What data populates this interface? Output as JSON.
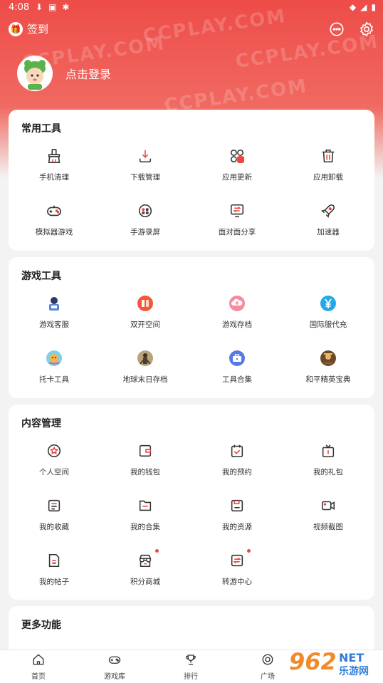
{
  "status_bar": {
    "time": "4:08",
    "icons": [
      "download-icon",
      "a-box-icon",
      "bug-icon",
      "wifi-icon",
      "signal-icon",
      "battery-icon"
    ]
  },
  "header": {
    "checkin_label": "签到",
    "watermark_text": "CCPLAY.COM",
    "login_label": "点击登录"
  },
  "sections": [
    {
      "title": "常用工具",
      "items": [
        {
          "label": "手机清理",
          "icon": "broom-icon"
        },
        {
          "label": "下载管理",
          "icon": "download-icon"
        },
        {
          "label": "应用更新",
          "icon": "apps-update-icon"
        },
        {
          "label": "应用卸载",
          "icon": "trash-icon"
        },
        {
          "label": "模拟器游戏",
          "icon": "gamepad-icon"
        },
        {
          "label": "手游录屏",
          "icon": "record-icon"
        },
        {
          "label": "面对面分享",
          "icon": "share-transfer-icon"
        },
        {
          "label": "加速器",
          "icon": "rocket-icon"
        }
      ]
    },
    {
      "title": "游戏工具",
      "items": [
        {
          "label": "游戏客服",
          "icon": "customer-service-icon"
        },
        {
          "label": "双开空间",
          "icon": "dual-space-icon"
        },
        {
          "label": "游戏存档",
          "icon": "cloud-save-icon"
        },
        {
          "label": "国际服代充",
          "icon": "yen-icon"
        },
        {
          "label": "托卡工具",
          "icon": "toca-icon"
        },
        {
          "label": "地球末日存档",
          "icon": "survivor-icon"
        },
        {
          "label": "工具合集",
          "icon": "toolbox-icon"
        },
        {
          "label": "和平精英宝典",
          "icon": "pubg-icon"
        }
      ]
    },
    {
      "title": "内容管理",
      "items": [
        {
          "label": "个人空间",
          "icon": "star-circle-icon",
          "dot": false
        },
        {
          "label": "我的钱包",
          "icon": "wallet-icon",
          "dot": false
        },
        {
          "label": "我的预约",
          "icon": "calendar-check-icon",
          "dot": false
        },
        {
          "label": "我的礼包",
          "icon": "gift-tv-icon",
          "dot": false
        },
        {
          "label": "我的收藏",
          "icon": "bookmark-list-icon",
          "dot": false
        },
        {
          "label": "我的合集",
          "icon": "folder-icon",
          "dot": false
        },
        {
          "label": "我的资源",
          "icon": "floppy-icon",
          "dot": false
        },
        {
          "label": "视频截图",
          "icon": "video-icon",
          "dot": false
        },
        {
          "label": "我的帖子",
          "icon": "document-icon",
          "dot": false
        },
        {
          "label": "积分商城",
          "icon": "store-icon",
          "dot": true
        },
        {
          "label": "转游中心",
          "icon": "swap-icon",
          "dot": true
        }
      ]
    },
    {
      "title": "更多功能",
      "items": []
    }
  ],
  "bottom_nav": [
    {
      "label": "首页",
      "icon": "home-icon"
    },
    {
      "label": "游戏库",
      "icon": "gamepad-icon"
    },
    {
      "label": "排行",
      "icon": "trophy-icon"
    },
    {
      "label": "广场",
      "icon": "target-icon"
    }
  ],
  "brand_badge": {
    "number": "962",
    "net": "NET",
    "cn": "乐游网"
  },
  "colors": {
    "accent": "#ee4c48",
    "nav_text": "#444444"
  }
}
